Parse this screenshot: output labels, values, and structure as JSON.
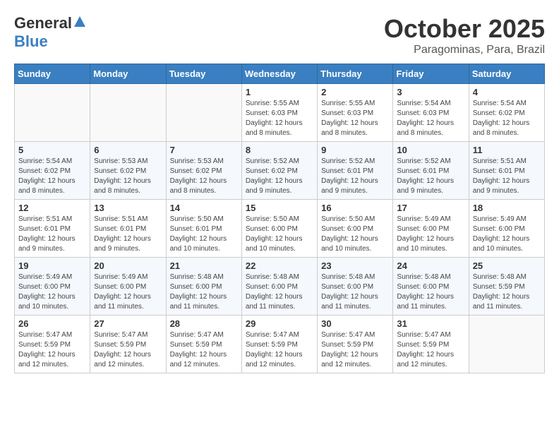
{
  "header": {
    "logo_general": "General",
    "logo_blue": "Blue",
    "month_title": "October 2025",
    "location": "Paragominas, Para, Brazil"
  },
  "days_of_week": [
    "Sunday",
    "Monday",
    "Tuesday",
    "Wednesday",
    "Thursday",
    "Friday",
    "Saturday"
  ],
  "weeks": [
    [
      {
        "day": "",
        "sunrise": "",
        "sunset": "",
        "daylight": ""
      },
      {
        "day": "",
        "sunrise": "",
        "sunset": "",
        "daylight": ""
      },
      {
        "day": "",
        "sunrise": "",
        "sunset": "",
        "daylight": ""
      },
      {
        "day": "1",
        "sunrise": "Sunrise: 5:55 AM",
        "sunset": "Sunset: 6:03 PM",
        "daylight": "Daylight: 12 hours and 8 minutes."
      },
      {
        "day": "2",
        "sunrise": "Sunrise: 5:55 AM",
        "sunset": "Sunset: 6:03 PM",
        "daylight": "Daylight: 12 hours and 8 minutes."
      },
      {
        "day": "3",
        "sunrise": "Sunrise: 5:54 AM",
        "sunset": "Sunset: 6:03 PM",
        "daylight": "Daylight: 12 hours and 8 minutes."
      },
      {
        "day": "4",
        "sunrise": "Sunrise: 5:54 AM",
        "sunset": "Sunset: 6:02 PM",
        "daylight": "Daylight: 12 hours and 8 minutes."
      }
    ],
    [
      {
        "day": "5",
        "sunrise": "Sunrise: 5:54 AM",
        "sunset": "Sunset: 6:02 PM",
        "daylight": "Daylight: 12 hours and 8 minutes."
      },
      {
        "day": "6",
        "sunrise": "Sunrise: 5:53 AM",
        "sunset": "Sunset: 6:02 PM",
        "daylight": "Daylight: 12 hours and 8 minutes."
      },
      {
        "day": "7",
        "sunrise": "Sunrise: 5:53 AM",
        "sunset": "Sunset: 6:02 PM",
        "daylight": "Daylight: 12 hours and 8 minutes."
      },
      {
        "day": "8",
        "sunrise": "Sunrise: 5:52 AM",
        "sunset": "Sunset: 6:02 PM",
        "daylight": "Daylight: 12 hours and 9 minutes."
      },
      {
        "day": "9",
        "sunrise": "Sunrise: 5:52 AM",
        "sunset": "Sunset: 6:01 PM",
        "daylight": "Daylight: 12 hours and 9 minutes."
      },
      {
        "day": "10",
        "sunrise": "Sunrise: 5:52 AM",
        "sunset": "Sunset: 6:01 PM",
        "daylight": "Daylight: 12 hours and 9 minutes."
      },
      {
        "day": "11",
        "sunrise": "Sunrise: 5:51 AM",
        "sunset": "Sunset: 6:01 PM",
        "daylight": "Daylight: 12 hours and 9 minutes."
      }
    ],
    [
      {
        "day": "12",
        "sunrise": "Sunrise: 5:51 AM",
        "sunset": "Sunset: 6:01 PM",
        "daylight": "Daylight: 12 hours and 9 minutes."
      },
      {
        "day": "13",
        "sunrise": "Sunrise: 5:51 AM",
        "sunset": "Sunset: 6:01 PM",
        "daylight": "Daylight: 12 hours and 9 minutes."
      },
      {
        "day": "14",
        "sunrise": "Sunrise: 5:50 AM",
        "sunset": "Sunset: 6:01 PM",
        "daylight": "Daylight: 12 hours and 10 minutes."
      },
      {
        "day": "15",
        "sunrise": "Sunrise: 5:50 AM",
        "sunset": "Sunset: 6:00 PM",
        "daylight": "Daylight: 12 hours and 10 minutes."
      },
      {
        "day": "16",
        "sunrise": "Sunrise: 5:50 AM",
        "sunset": "Sunset: 6:00 PM",
        "daylight": "Daylight: 12 hours and 10 minutes."
      },
      {
        "day": "17",
        "sunrise": "Sunrise: 5:49 AM",
        "sunset": "Sunset: 6:00 PM",
        "daylight": "Daylight: 12 hours and 10 minutes."
      },
      {
        "day": "18",
        "sunrise": "Sunrise: 5:49 AM",
        "sunset": "Sunset: 6:00 PM",
        "daylight": "Daylight: 12 hours and 10 minutes."
      }
    ],
    [
      {
        "day": "19",
        "sunrise": "Sunrise: 5:49 AM",
        "sunset": "Sunset: 6:00 PM",
        "daylight": "Daylight: 12 hours and 10 minutes."
      },
      {
        "day": "20",
        "sunrise": "Sunrise: 5:49 AM",
        "sunset": "Sunset: 6:00 PM",
        "daylight": "Daylight: 12 hours and 11 minutes."
      },
      {
        "day": "21",
        "sunrise": "Sunrise: 5:48 AM",
        "sunset": "Sunset: 6:00 PM",
        "daylight": "Daylight: 12 hours and 11 minutes."
      },
      {
        "day": "22",
        "sunrise": "Sunrise: 5:48 AM",
        "sunset": "Sunset: 6:00 PM",
        "daylight": "Daylight: 12 hours and 11 minutes."
      },
      {
        "day": "23",
        "sunrise": "Sunrise: 5:48 AM",
        "sunset": "Sunset: 6:00 PM",
        "daylight": "Daylight: 12 hours and 11 minutes."
      },
      {
        "day": "24",
        "sunrise": "Sunrise: 5:48 AM",
        "sunset": "Sunset: 6:00 PM",
        "daylight": "Daylight: 12 hours and 11 minutes."
      },
      {
        "day": "25",
        "sunrise": "Sunrise: 5:48 AM",
        "sunset": "Sunset: 5:59 PM",
        "daylight": "Daylight: 12 hours and 11 minutes."
      }
    ],
    [
      {
        "day": "26",
        "sunrise": "Sunrise: 5:47 AM",
        "sunset": "Sunset: 5:59 PM",
        "daylight": "Daylight: 12 hours and 12 minutes."
      },
      {
        "day": "27",
        "sunrise": "Sunrise: 5:47 AM",
        "sunset": "Sunset: 5:59 PM",
        "daylight": "Daylight: 12 hours and 12 minutes."
      },
      {
        "day": "28",
        "sunrise": "Sunrise: 5:47 AM",
        "sunset": "Sunset: 5:59 PM",
        "daylight": "Daylight: 12 hours and 12 minutes."
      },
      {
        "day": "29",
        "sunrise": "Sunrise: 5:47 AM",
        "sunset": "Sunset: 5:59 PM",
        "daylight": "Daylight: 12 hours and 12 minutes."
      },
      {
        "day": "30",
        "sunrise": "Sunrise: 5:47 AM",
        "sunset": "Sunset: 5:59 PM",
        "daylight": "Daylight: 12 hours and 12 minutes."
      },
      {
        "day": "31",
        "sunrise": "Sunrise: 5:47 AM",
        "sunset": "Sunset: 5:59 PM",
        "daylight": "Daylight: 12 hours and 12 minutes."
      },
      {
        "day": "",
        "sunrise": "",
        "sunset": "",
        "daylight": ""
      }
    ]
  ]
}
